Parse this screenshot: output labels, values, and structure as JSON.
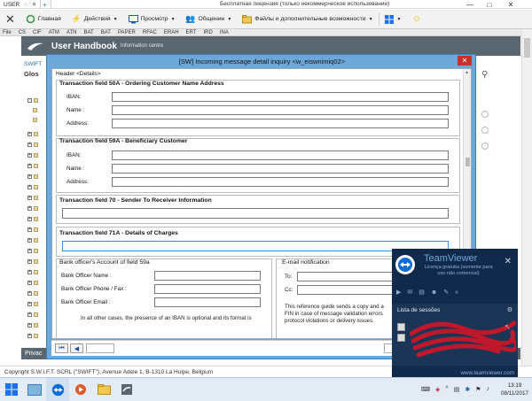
{
  "tv": {
    "tab_label": "USER",
    "license_text": "Бесплатная лицензия (только некоммерческое использование)",
    "toolbar": {
      "home": "Главная",
      "actions": "Действия",
      "view": "Просмотр",
      "communication": "Общение",
      "files": "Файлы и дополнительные возможности"
    }
  },
  "app": {
    "menu": [
      "File",
      "CS",
      "CIF",
      "ATM",
      "ATN",
      "BAT",
      "BAT",
      "PAPER",
      "RFAC",
      "ERAH",
      "ERT",
      "IRD",
      "INA"
    ],
    "title": "User Handbook",
    "subtitle": "Information centre",
    "left_link": "SWIFT",
    "left_bold": "Glos",
    "status_text": "Privac",
    "copyright": "Copyright S.W.I.F.T. SCRL (\"SWIFT\"), Avenue Adèle 1, B-1310 La Hulpe, Belgium"
  },
  "dialog": {
    "title": "[SW] Incoming message detail inquiry <w_eiswnimiq02>",
    "header": "Header <Details>",
    "sec50": {
      "title": "Transaction field 50A - Ordering Customer Name Address",
      "iban": "IBAN:",
      "name": "Name :",
      "address": "Address:"
    },
    "sec59": {
      "title": "Transaction field 59A - Beneficiary Customer",
      "iban": "IBAN:",
      "name": "Name :",
      "address": "Address:"
    },
    "sec70": {
      "title": "Transaction field 70 - Sender To Receiver Information"
    },
    "sec71": {
      "title": "Transaction field 71A - Details of Charges"
    },
    "officer": {
      "title": "Bank officer's Account of field 59a",
      "name": "Bank Officer Name :",
      "phone": "Bank Officer Phone / Fax :",
      "email": "Bank Officer Email :",
      "note": "In all other cases, the presence of an IBAN is optional and its format is"
    },
    "email": {
      "title": "E-mail notification",
      "to": "To:",
      "cc": "Cc:",
      "note1": "This reference guide sends a copy and a",
      "note2": "FIN in case of message validation errors",
      "note3": "protocol violations or delivery issues."
    }
  },
  "teamviewer": {
    "name": "TeamViewer",
    "license": "Licença gratuita (somente para uso não comercial)",
    "list_header": "Lista de sessões",
    "url": "www.teamviewer.com"
  },
  "taskbar": {
    "time": "13:19",
    "date": "08/11/2017"
  }
}
